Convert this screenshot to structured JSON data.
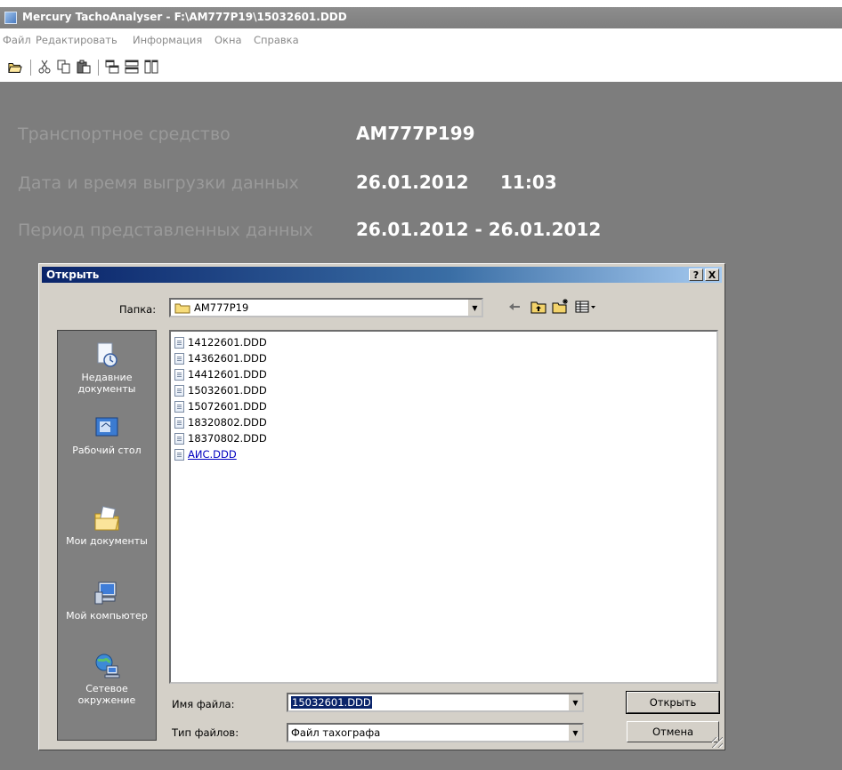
{
  "app": {
    "title": "Mercury TachoAnalyser - F:\\AM777P19\\15032601.DDD",
    "menu": [
      "Файл",
      "Редактировать",
      "Информация",
      "Окна",
      "Справка"
    ]
  },
  "info": {
    "vehicle_label": "Транспортное средство",
    "vehicle_value": "AM777P199",
    "download_label": "Дата и время выгрузки данных",
    "download_date": "26.01.2012",
    "download_time": "11:03",
    "period_label": "Период представленных данных",
    "period_value": "26.01.2012 - 26.01.2012"
  },
  "dialog": {
    "title": "Открыть",
    "help_button": "?",
    "close_button": "X",
    "folder_label": "Папка:",
    "folder_value": "AM777P19",
    "places": [
      {
        "label": "Недавние документы",
        "icon": "recent-documents-icon"
      },
      {
        "label": "Рабочий стол",
        "icon": "desktop-icon"
      },
      {
        "label": "Мои документы",
        "icon": "my-documents-icon"
      },
      {
        "label": "Мой компьютер",
        "icon": "my-computer-icon"
      },
      {
        "label": "Сетевое окружение",
        "icon": "network-icon"
      }
    ],
    "files": [
      "14122601.DDD",
      "14362601.DDD",
      "14412601.DDD",
      "15032601.DDD",
      "15072601.DDD",
      "18320802.DDD",
      "18370802.DDD",
      "АИС.DDD"
    ],
    "filename_label": "Имя файла:",
    "filename_value": "15032601.DDD",
    "filetype_label": "Тип файлов:",
    "filetype_value": "Файл тахографа",
    "open_button": "Открыть",
    "cancel_button": "Отмена"
  }
}
